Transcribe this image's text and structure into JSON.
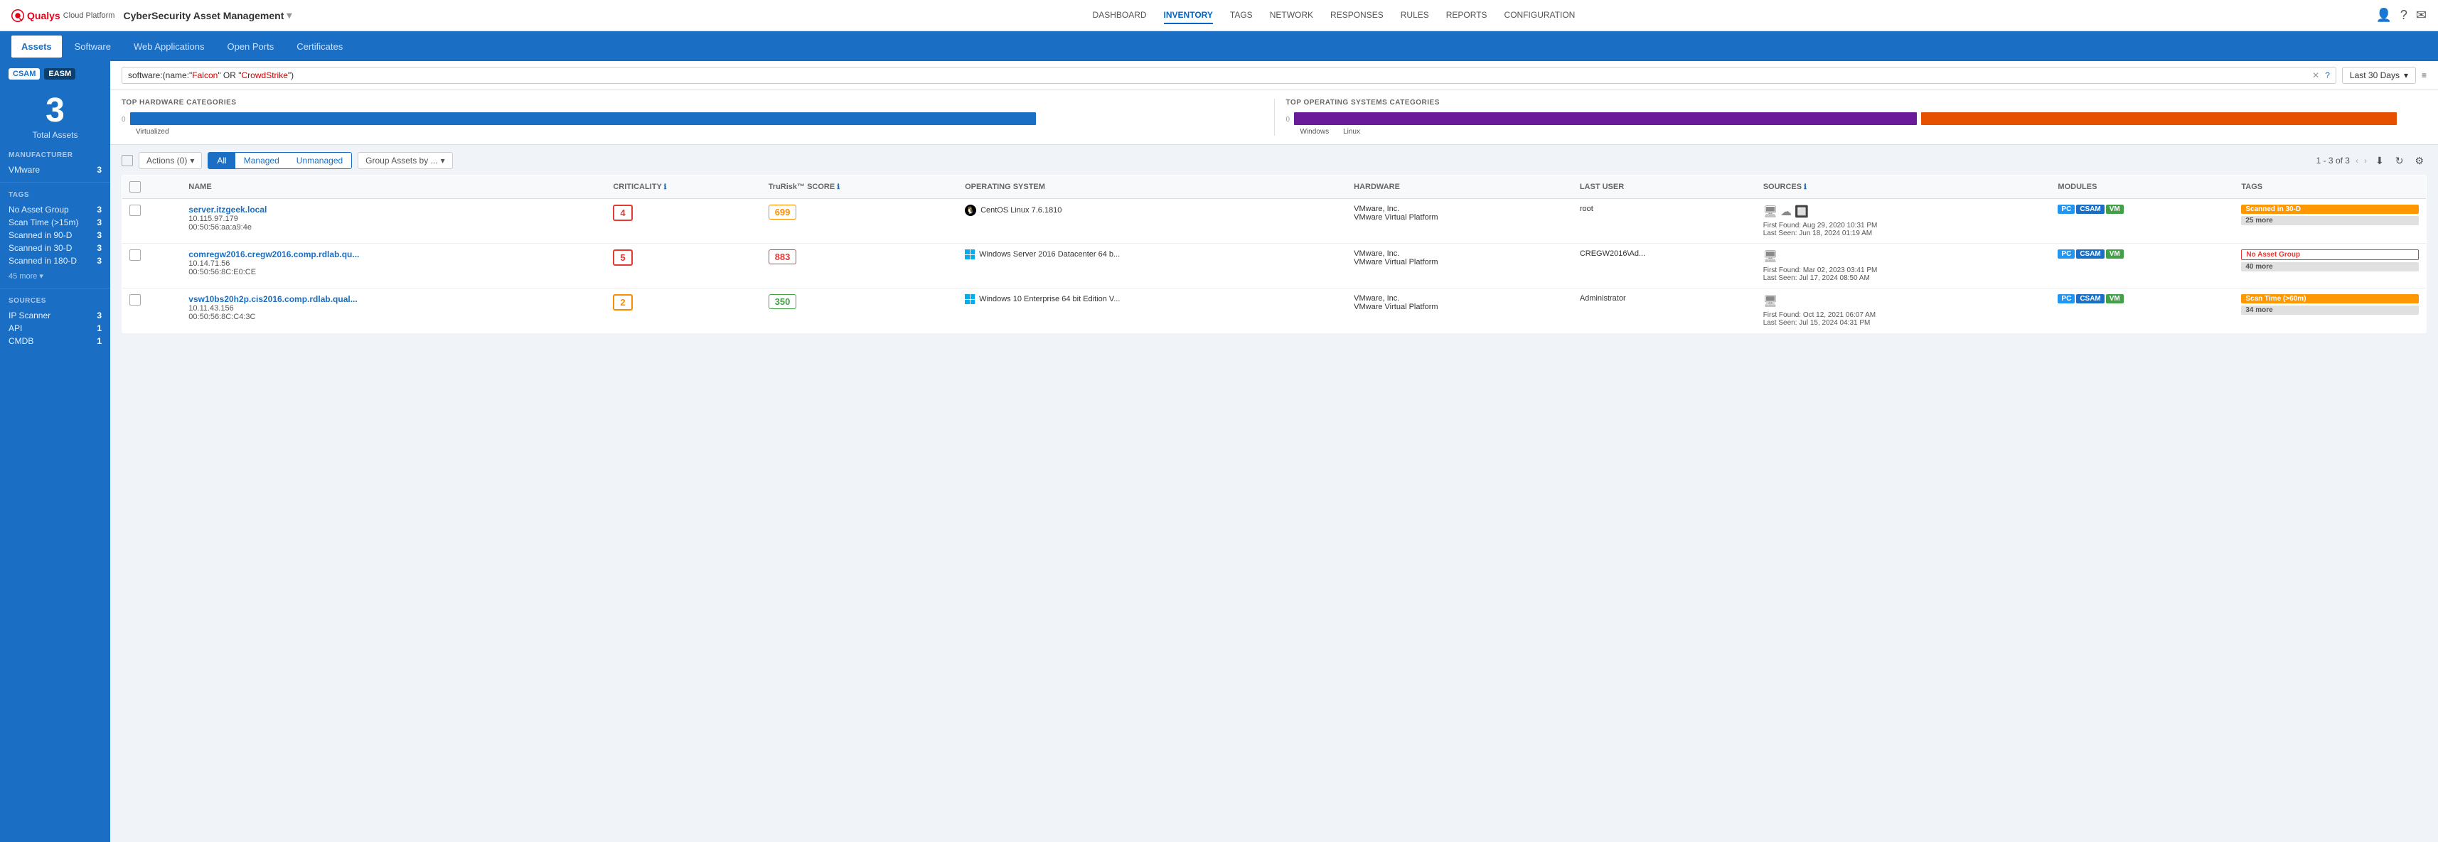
{
  "app": {
    "logo": "Qualys",
    "platform": "Cloud Platform",
    "title": "CyberSecurity Asset Management",
    "chevron": "▾"
  },
  "top_nav": {
    "items": [
      {
        "label": "DASHBOARD",
        "active": false
      },
      {
        "label": "INVENTORY",
        "active": true
      },
      {
        "label": "TAGS",
        "active": false
      },
      {
        "label": "NETWORK",
        "active": false
      },
      {
        "label": "RESPONSES",
        "active": false
      },
      {
        "label": "RULES",
        "active": false
      },
      {
        "label": "REPORTS",
        "active": false
      },
      {
        "label": "CONFIGURATION",
        "active": false
      }
    ]
  },
  "sub_tabs": [
    {
      "label": "Assets",
      "active": true
    },
    {
      "label": "Software",
      "active": false
    },
    {
      "label": "Web Applications",
      "active": false
    },
    {
      "label": "Open Ports",
      "active": false
    },
    {
      "label": "Certificates",
      "active": false
    }
  ],
  "sidebar": {
    "badges": [
      "CSAM",
      "EASM"
    ],
    "total_count": "3",
    "total_label": "Total Assets",
    "manufacturer_title": "MANUFACTURER",
    "manufacturer_items": [
      {
        "label": "VMware",
        "count": "3"
      }
    ],
    "tags_title": "TAGS",
    "tags_items": [
      {
        "label": "No Asset Group",
        "count": "3"
      },
      {
        "label": "Scan Time (>15m)",
        "count": "3"
      },
      {
        "label": "Scanned in 90-D",
        "count": "3"
      },
      {
        "label": "Scanned in 30-D",
        "count": "3"
      },
      {
        "label": "Scanned in 180-D",
        "count": "3"
      }
    ],
    "tags_more": "45 more ▾",
    "sources_title": "SOURCES",
    "sources_items": [
      {
        "label": "IP Scanner",
        "count": "3"
      },
      {
        "label": "API",
        "count": "1"
      },
      {
        "label": "CMDB",
        "count": "1"
      }
    ]
  },
  "search": {
    "query_prefix": "software:(name:\"",
    "query_highlight1": "Falcon",
    "query_mid": "\" OR \"",
    "query_highlight2": "CrowdStrike",
    "query_suffix": "\")",
    "date_filter": "Last 30 Days"
  },
  "charts": {
    "hardware_title": "TOP HARDWARE CATEGORIES",
    "hardware_bars": [
      {
        "label": "Virtualized",
        "value": 100,
        "color": "#1a6fc4",
        "scale_start": "0"
      }
    ],
    "os_title": "TOP OPERATING SYSTEMS CATEGORIES",
    "os_bars": [
      {
        "label": "Windows",
        "value": 55,
        "color": "#6a1b9a"
      },
      {
        "label": "Linux",
        "value": 45,
        "color": "#e65100"
      }
    ]
  },
  "toolbar": {
    "actions_label": "Actions (0)",
    "all_label": "All",
    "managed_label": "Managed",
    "unmanaged_label": "Unmanaged",
    "group_label": "Group Assets by ...",
    "pagination": "1 - 3 of 3",
    "download_icon": "⬇",
    "refresh_icon": "↻",
    "settings_icon": "⚙"
  },
  "table": {
    "columns": [
      "NAME",
      "CRITICALITY",
      "TruRisk™ SCORE",
      "OPERATING SYSTEM",
      "HARDWARE",
      "LAST USER",
      "SOURCES",
      "MODULES",
      "TAGS"
    ],
    "rows": [
      {
        "name": "server.itzgeek.local",
        "ip1": "10.115.97.179",
        "ip2": "00:50:56:aa:a9:4e",
        "criticality": "4",
        "criticality_color": "red",
        "tru_risk": "699",
        "tru_risk_level": "med",
        "os_icon": "linux",
        "os": "CentOS Linux 7.6.1810",
        "hardware_vendor": "VMware, Inc.",
        "hardware_type": "VMware Virtual Platform",
        "last_user": "root",
        "first_found": "First Found: Aug 29, 2020 10:31 PM",
        "last_seen": "Last Seen: Jun 18, 2024 01:19 AM",
        "modules": [
          "PC",
          "CSAM",
          "VM"
        ],
        "tags": [
          {
            "label": "Scanned in 30-D",
            "type": "orange"
          },
          {
            "label": "25 more",
            "type": "more"
          }
        ]
      },
      {
        "name": "comregw2016.cregw2016.comp.rdlab.qu...",
        "ip1": "10.14.71.56",
        "ip2": "00:50:56:8C:E0:CE",
        "criticality": "5",
        "criticality_color": "red",
        "tru_risk": "883",
        "tru_risk_level": "high",
        "os_icon": "windows",
        "os": "Windows Server 2016 Datacenter 64 b...",
        "hardware_vendor": "VMware, Inc.",
        "hardware_type": "VMware Virtual Platform",
        "last_user": "CREGW2016\\Ad...",
        "first_found": "First Found: Mar 02, 2023 03:41 PM",
        "last_seen": "Last Seen: Jul 17, 2024 08:50 AM",
        "modules": [
          "PC",
          "CSAM",
          "VM"
        ],
        "tags": [
          {
            "label": "No Asset Group",
            "type": "red-outline"
          },
          {
            "label": "40 more",
            "type": "more"
          }
        ]
      },
      {
        "name": "vsw10bs20h2p.cis2016.comp.rdlab.qual...",
        "ip1": "10.11.43.156",
        "ip2": "00:50:56:8C:C4:3C",
        "criticality": "2",
        "criticality_color": "orange",
        "tru_risk": "350",
        "tru_risk_level": "low",
        "os_icon": "windows",
        "os": "Windows 10 Enterprise 64 bit Edition V...",
        "hardware_vendor": "VMware, Inc.",
        "hardware_type": "VMware Virtual Platform",
        "last_user": "Administrator",
        "first_found": "First Found: Oct 12, 2021 06:07 AM",
        "last_seen": "Last Seen: Jul 15, 2024 04:31 PM",
        "modules": [
          "PC",
          "CSAM",
          "VM"
        ],
        "tags": [
          {
            "label": "Scan Time (>60m)",
            "type": "orange"
          },
          {
            "label": "34 more",
            "type": "more"
          }
        ]
      }
    ]
  }
}
